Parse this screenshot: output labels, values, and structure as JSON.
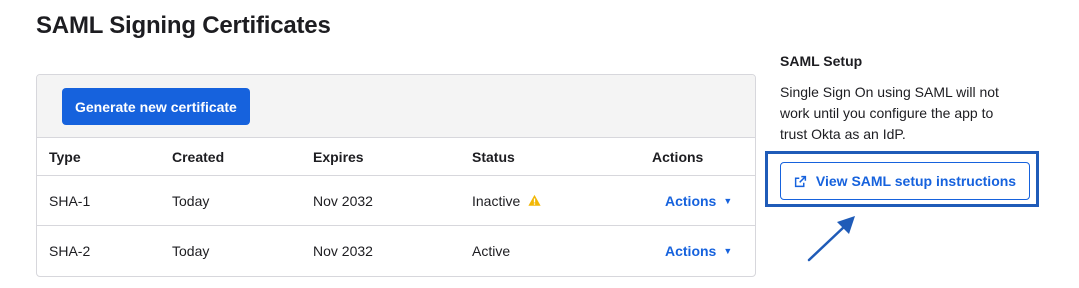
{
  "page": {
    "title": "SAML Signing Certificates"
  },
  "toolbar": {
    "generate_label": "Generate new certificate"
  },
  "table": {
    "headers": [
      "Type",
      "Created",
      "Expires",
      "Status",
      "Actions"
    ],
    "rows": [
      {
        "type": "SHA-1",
        "created": "Today",
        "expires": "Nov 2032",
        "status": "Inactive",
        "status_icon": "warning-icon",
        "actions": "Actions"
      },
      {
        "type": "SHA-2",
        "created": "Today",
        "expires": "Nov 2032",
        "status": "Active",
        "actions": "Actions"
      }
    ]
  },
  "side": {
    "heading": "SAML Setup",
    "description": "Single Sign On using SAML will not work until you configure the app to trust Okta as an IdP.",
    "button_label": "View SAML setup instructions",
    "button_icon": "external-link-icon"
  },
  "colors": {
    "accent": "#1662dd",
    "highlight": "#1f5bb8",
    "warning": "#f2b705"
  }
}
